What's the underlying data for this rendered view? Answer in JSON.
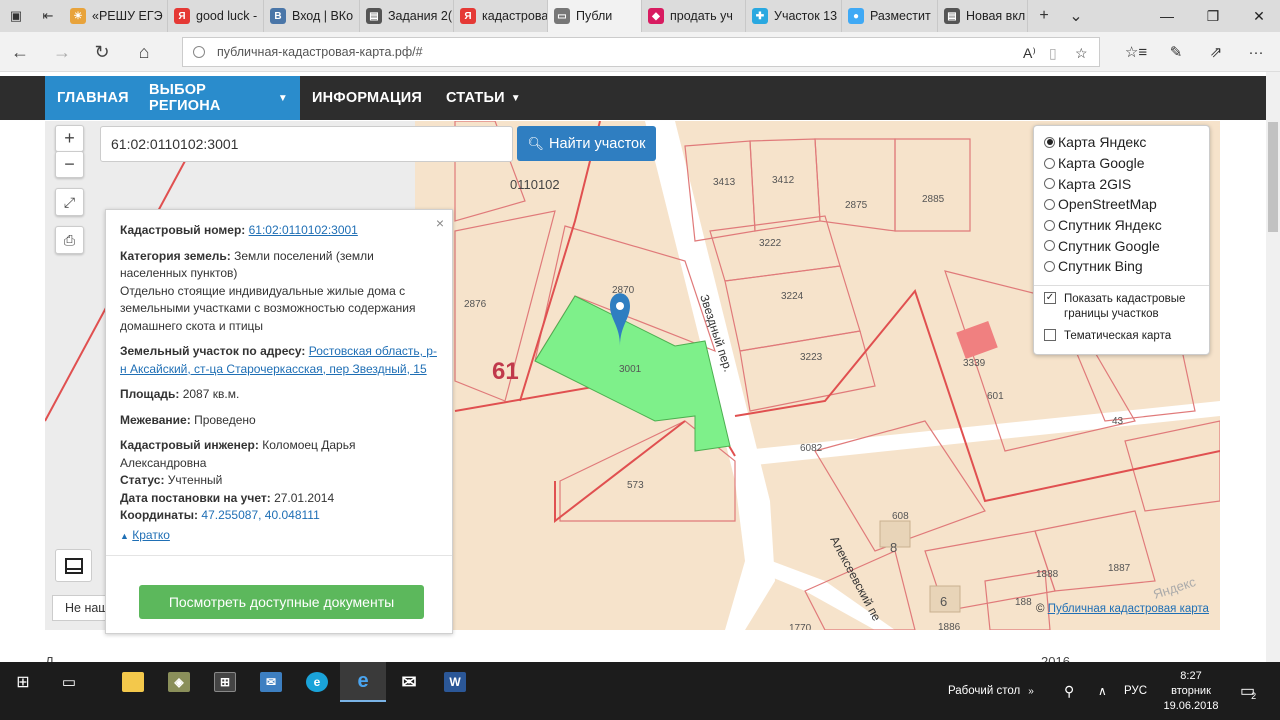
{
  "browser": {
    "tabs": [
      {
        "label": "«РЕШУ ЕГЭ",
        "fav_color": "#e8a33b",
        "fav_glyph": "☀"
      },
      {
        "label": "good luck -",
        "fav_color": "#e53935",
        "fav_glyph": "Я"
      },
      {
        "label": "Вход | ВКо",
        "fav_color": "#4a76a8",
        "fav_glyph": "В"
      },
      {
        "label": "Задания 2(",
        "fav_color": "#555555",
        "fav_glyph": "▤"
      },
      {
        "label": "кадастрова",
        "fav_color": "#e53935",
        "fav_glyph": "Я"
      },
      {
        "label": "Публи",
        "fav_color": "#777777",
        "fav_glyph": "▭",
        "active": true
      },
      {
        "label": "продать уч",
        "fav_color": "#d81b60",
        "fav_glyph": "◆"
      },
      {
        "label": "Участок 13",
        "fav_color": "#29a8e0",
        "fav_glyph": "✚"
      },
      {
        "label": "Разместит",
        "fav_color": "#3fa9f5",
        "fav_glyph": "●"
      },
      {
        "label": "Новая вкл",
        "fav_color": "#555555",
        "fav_glyph": "▤"
      }
    ],
    "url": "публичная-кадастровая-карта.рф/#"
  },
  "site_nav": {
    "home": "ГЛАВНАЯ",
    "region": "ВЫБОР РЕГИОНА",
    "info": "ИНФОРМАЦИЯ",
    "articles": "СТАТЬИ"
  },
  "search": {
    "value": "61:02:0110102:3001",
    "button": "Найти участок"
  },
  "map_labels": {
    "quarter": "0110102",
    "region": "61",
    "street1": "Звездный пер.",
    "street2": "Алексеевский пе",
    "lots": [
      "3413",
      "3412",
      "2875",
      "2885",
      "3222",
      "3224",
      "3223",
      "2870",
      "2876",
      "3001",
      "573",
      "6082",
      "601",
      "43",
      "3339",
      "608",
      "8",
      "1888",
      "1887",
      "6",
      "1770",
      "188",
      "1886"
    ],
    "watermark": "Яндекс"
  },
  "popup": {
    "close": "×",
    "cadastral_label": "Кадастровый номер:",
    "cadastral_value": "61:02:0110102:3001",
    "category_label": "Категория земель:",
    "category_value": "Земли поселений (земли населенных пунктов)",
    "usage": "Отдельно стоящие индивидуальные жилые дома с земельными участками с возможностью содержания домашнего скота и птицы",
    "address_label": "Земельный участок по адресу:",
    "address_value": "Ростовская область, р-н Аксайский, ст-ца Старочеркасская, пер Звездный, 15",
    "area_label": "Площадь:",
    "area_value": "2087 кв.м.",
    "survey_label": "Межевание:",
    "survey_value": "Проведено",
    "engineer_label": "Кадастровый инженер:",
    "engineer_value": "Коломоец Дарья Александровна",
    "status_label": "Статус:",
    "status_value": "Учтенный",
    "date_label": "Дата постановки на учет:",
    "date_value": "27.01.2014",
    "coords_label": "Координаты:",
    "coords_value": "47.255087, 40.048111",
    "short": "Кратко",
    "docs_button": "Посмотреть доступные документы"
  },
  "layers": {
    "options": [
      "Карта Яндекс",
      "Карта Google",
      "Карта 2GIS",
      "OpenStreetMap",
      "Спутник Яндекс",
      "Спутник Google",
      "Спутник Bing"
    ],
    "selected": 0,
    "show_borders": "Показать кадастровые границы участков",
    "show_borders_checked": true,
    "thematic": "Тематическая карта",
    "thematic_checked": false
  },
  "copyright": {
    "symbol": "©",
    "link": "Публичная кадастровая карта"
  },
  "scale_box": "Не наш",
  "below_text": "Д",
  "below_text_right": "2016",
  "taskbar": {
    "desktop": "Рабочий стол",
    "lang": "РУС",
    "time": "8:27",
    "day": "вторник",
    "date": "19.06.2018",
    "notifications": "2"
  }
}
